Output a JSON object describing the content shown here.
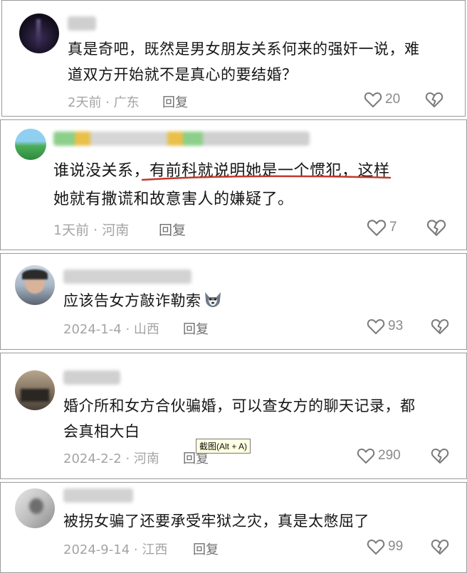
{
  "comments": [
    {
      "username": "娜萌",
      "text": "真是奇吧，既然是男女朋友关系何来的强奸一说，难道双方开始就不是真心的要结婚？",
      "line1": "真是奇吧，既然是男女朋友关系何来的强奸一说，难",
      "line2": "道双方开始就不是真心的要结婚？",
      "time": "2天前",
      "location": "广东",
      "reply_label": "回复",
      "likes": "20"
    },
    {
      "username": "一米阳光 · 霍山许家圈",
      "line1_pre": "谁说没关系",
      "line1_marked": "，有前科就说明她是一个惯犯，",
      "line1_post": "这样",
      "line2": "她就有撒谎和故意害人的嫌疑了。",
      "time": "1天前",
      "location": "河南",
      "reply_label": "回复",
      "likes": "7"
    },
    {
      "username": "神回观影 | 欢乐农场",
      "text": "应该告女方敲诈勒索",
      "time": "2024-1-4",
      "location": "山西",
      "reply_label": "回复",
      "likes": "93"
    },
    {
      "username": "碎碎抱抱",
      "line1": "婚介所和女方合伙骗婚，可以查女方的聊天记录，都",
      "line2": "会真相大白",
      "time": "2024-2-2",
      "location": "河南",
      "reply_label": "回复",
      "likes": "290"
    },
    {
      "username": "九瑞星达人",
      "text": "被拐女骗了还要承受牢狱之灾，真是太憋屈了",
      "time": "2024-9-14",
      "location": "江西",
      "reply_label": "回复",
      "likes": "99"
    }
  ],
  "tooltip": "截图(Alt + A)",
  "meta_separator": "·",
  "colors": {
    "underline": "#c0392b",
    "meta": "#a4a4a4",
    "border": "#9a9a9a"
  }
}
